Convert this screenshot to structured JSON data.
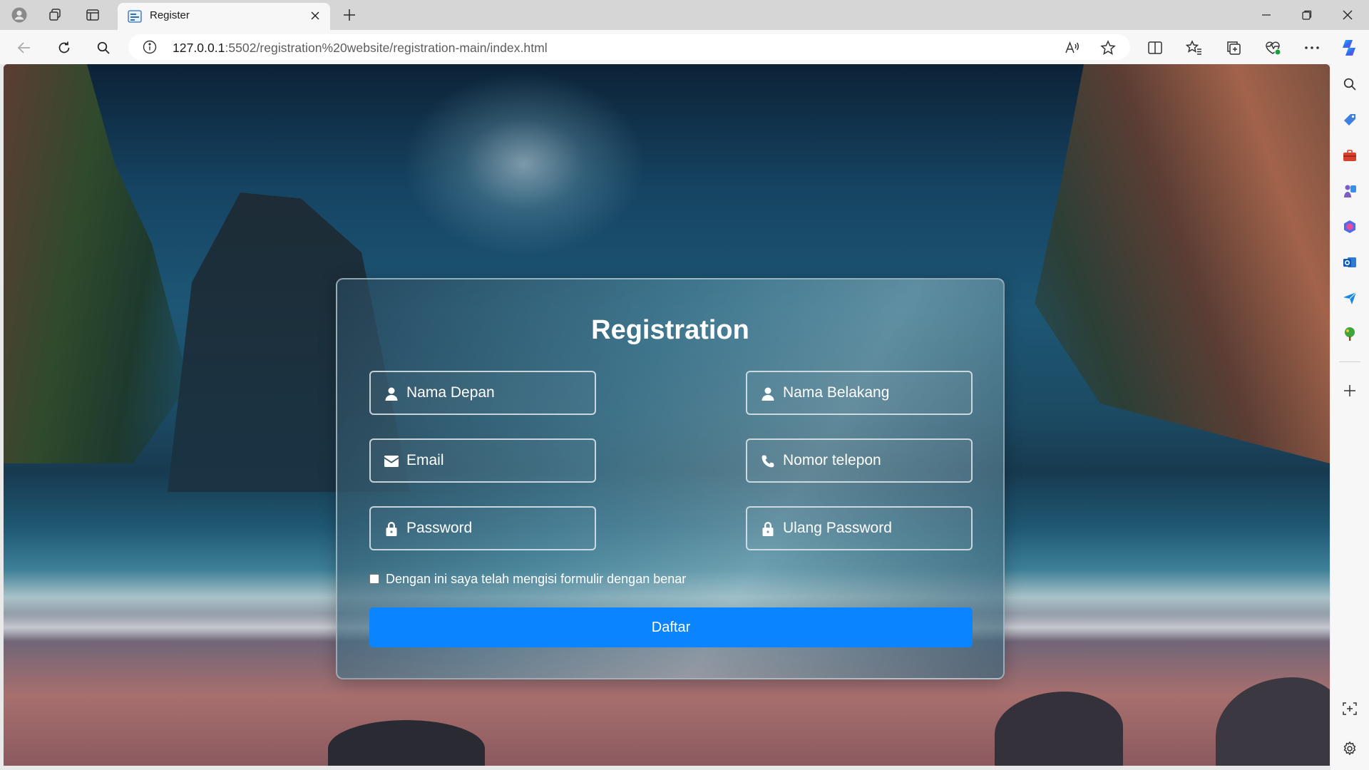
{
  "browser": {
    "tab_title": "Register",
    "url_host": "127.0.0.1",
    "url_rest": ":5502/registration%20website/registration-main/index.html",
    "colors": {
      "tabstrip": "#d6d6d6",
      "toolbar": "#f7f7f7",
      "accent": "#0a84ff"
    },
    "toolbar_icons": [
      "read-aloud-icon",
      "favorite-star-icon",
      "split-screen-icon",
      "favorites-icon",
      "collections-icon",
      "browser-essentials-icon",
      "more-icon",
      "copilot-icon"
    ],
    "sidebar_icons": [
      "search-icon",
      "shopping-tag-icon",
      "tools-icon",
      "games-icon",
      "microsoft365-icon",
      "outlook-icon",
      "send-icon",
      "tree-icon",
      "add-icon",
      "screenshot-icon",
      "settings-icon"
    ]
  },
  "form": {
    "title": "Registration",
    "fields": {
      "first_name": {
        "placeholder": "Nama Depan",
        "icon": "user-icon"
      },
      "last_name": {
        "placeholder": "Nama Belakang",
        "icon": "user-icon"
      },
      "email": {
        "placeholder": "Email",
        "icon": "envelope-icon"
      },
      "phone": {
        "placeholder": "Nomor telepon",
        "icon": "phone-icon"
      },
      "password": {
        "placeholder": "Password",
        "icon": "lock-icon"
      },
      "repeat_password": {
        "placeholder": "Ulang Password",
        "icon": "lock-icon"
      }
    },
    "agree_label": "Dengan ini saya telah mengisi formulir dengan benar",
    "agree_checked": false,
    "submit_label": "Daftar"
  }
}
